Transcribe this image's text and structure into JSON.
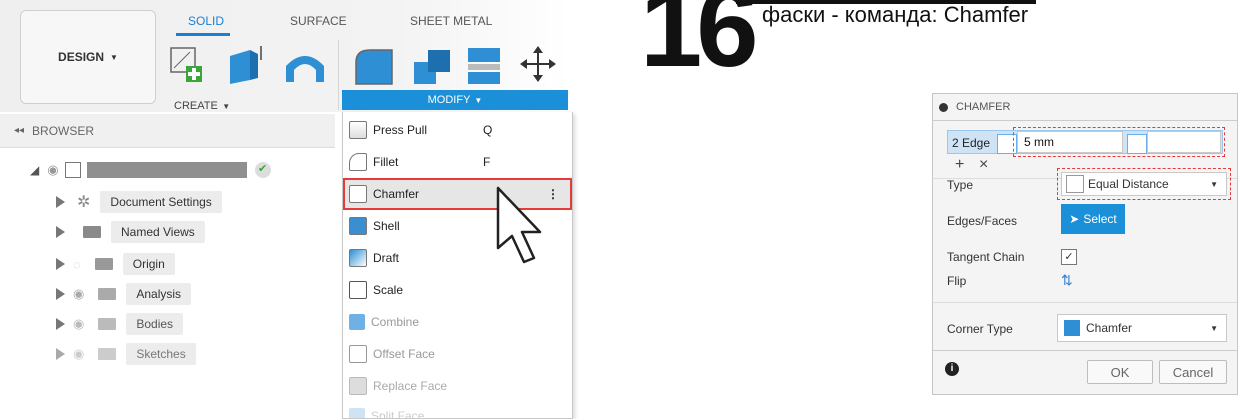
{
  "toolbar": {
    "design_label": "DESIGN",
    "tabs": [
      "SOLID",
      "SURFACE",
      "SHEET METAL"
    ],
    "create_label": "CREATE",
    "modify_label": "MODIFY"
  },
  "browser": {
    "title": "BROWSER",
    "items": [
      {
        "label": "Document Settings"
      },
      {
        "label": "Named Views"
      },
      {
        "label": "Origin"
      },
      {
        "label": "Analysis"
      },
      {
        "label": "Bodies"
      },
      {
        "label": "Sketches"
      }
    ]
  },
  "menu": {
    "items": [
      {
        "label": "Press Pull",
        "key": "Q"
      },
      {
        "label": "Fillet",
        "key": "F"
      },
      {
        "label": "Chamfer",
        "key": "⋮"
      },
      {
        "label": "Shell",
        "key": ""
      },
      {
        "label": "Draft",
        "key": ""
      },
      {
        "label": "Scale",
        "key": ""
      },
      {
        "label": "Combine",
        "key": ""
      },
      {
        "label": "Offset Face",
        "key": ""
      },
      {
        "label": "Replace Face",
        "key": ""
      },
      {
        "label": "Split Face",
        "key": ""
      }
    ]
  },
  "step": {
    "number": "16",
    "heading": "фаски - команда: Chamfer"
  },
  "dialog": {
    "title": "CHAMFER",
    "edge_label": "2 Edge",
    "distance_value": "5 mm",
    "type_label": "Type",
    "type_value": "Equal Distance",
    "edges_label": "Edges/Faces",
    "select_label": "Select",
    "tangent_label": "Tangent Chain",
    "flip_label": "Flip",
    "corner_label": "Corner Type",
    "corner_value": "Chamfer",
    "ok_label": "OK",
    "cancel_label": "Cancel"
  },
  "colors": {
    "accent": "#1b8fd7",
    "highlight": "#e53b3b"
  }
}
